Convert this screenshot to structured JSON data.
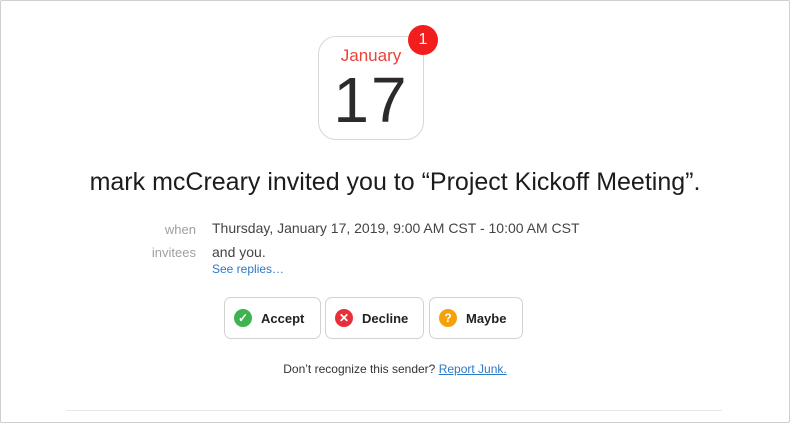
{
  "calendar": {
    "month": "January",
    "day": "17",
    "badge_count": "1"
  },
  "headline": "mark mcCreary invited you to “Project Kickoff Meeting”.",
  "details": {
    "when_label": "when",
    "when_value": "Thursday, January 17, 2019, 9:00 AM CST - 10:00 AM CST",
    "invitees_label": "invitees",
    "invitees_value": "and you.",
    "see_replies": "See replies…"
  },
  "actions": {
    "accept": "Accept",
    "decline": "Decline",
    "maybe": "Maybe"
  },
  "colors": {
    "accept": "#3fb34f",
    "decline": "#e8303a",
    "maybe": "#f5a10a",
    "badge": "#f21d1d",
    "link": "#2c78c8"
  },
  "footer": {
    "text": "Don’t recognize this sender?",
    "link": "Report Junk."
  }
}
